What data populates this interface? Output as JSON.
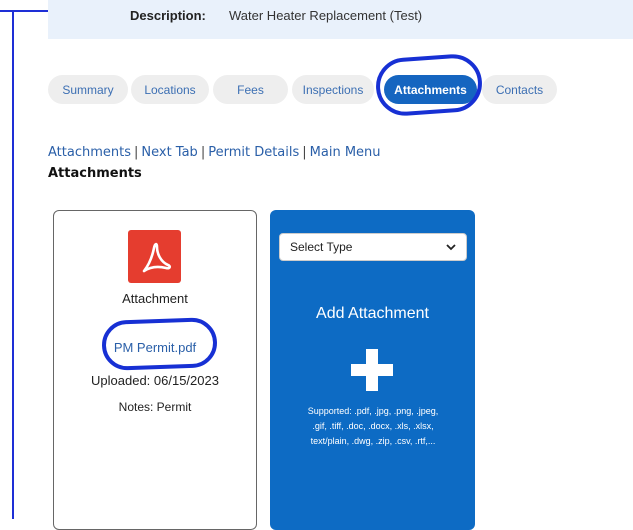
{
  "description": {
    "label": "Description:",
    "value": "Water Heater Replacement (Test)"
  },
  "tabs": [
    {
      "label": "Summary",
      "active": false
    },
    {
      "label": "Locations",
      "active": false
    },
    {
      "label": "Fees",
      "active": false
    },
    {
      "label": "Inspections",
      "active": false
    },
    {
      "label": "Attachments",
      "active": true
    },
    {
      "label": "Contacts",
      "active": false
    }
  ],
  "links": [
    "Attachments",
    "Next Tab",
    "Permit Details",
    "Main Menu"
  ],
  "section_title": "Attachments",
  "attachment": {
    "icon": "pdf-icon",
    "type": "Attachment",
    "file_name": "PM Permit.pdf",
    "uploaded": "Uploaded: 06/15/2023",
    "notes": "Notes: Permit"
  },
  "add_attachment": {
    "select_value": "Select Type",
    "title": "Add Attachment",
    "supported_lines": [
      "Supported: .pdf, .jpg, .png, .jpeg,",
      ".gif, .tiff, .doc, .docx, .xls, .xlsx,",
      "text/plain, .dwg, .zip, .csv, .rtf,..."
    ]
  },
  "colors": {
    "accent": "#1565c0",
    "annotation": "#1730d4",
    "pdf": "#e53d2f",
    "link": "#2a5fa8"
  }
}
